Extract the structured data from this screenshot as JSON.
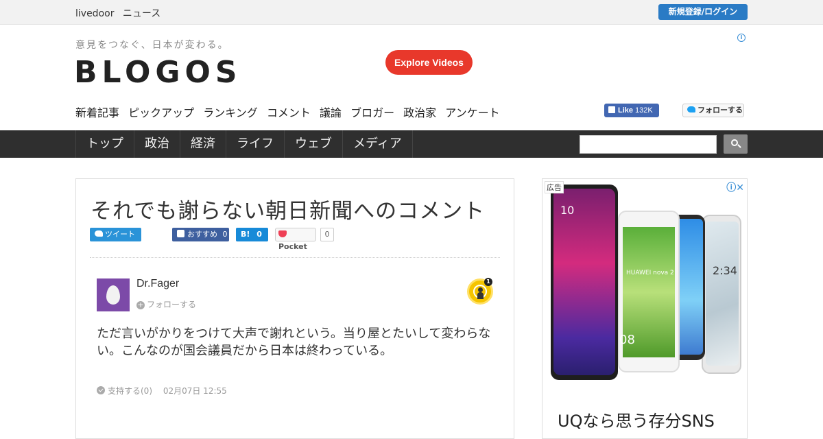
{
  "topbar": {
    "brand_1": "livedoor",
    "brand_2": "ニュース",
    "login_label": "新規登録/ログイン"
  },
  "masthead": {
    "tagline": "意見をつなぐ、日本が変わる。",
    "logo": "BLOGOS",
    "explore_label": "Explore Videos"
  },
  "subnav": [
    "新着記事",
    "ピックアップ",
    "ランキング",
    "コメント",
    "議論",
    "ブロガー",
    "政治家",
    "アンケート"
  ],
  "social": {
    "like_label": "Like",
    "like_count": "132K",
    "follow_label": "フォローする"
  },
  "navbar": {
    "items": [
      "トップ",
      "政治",
      "経済",
      "ライフ",
      "ウェブ",
      "メディア"
    ],
    "search_placeholder": ""
  },
  "article": {
    "title": "それでも謝らない朝日新聞へのコメント",
    "share": {
      "tweet": "ツイート",
      "fb_recommend": "おすすめ",
      "fb_count": "0",
      "hatena_icon": "B!",
      "hatena_count": "0",
      "pocket_label": "Pocket",
      "pocket_count": "0"
    },
    "user": {
      "name": "Dr.Fager",
      "follow_label": "フォローする",
      "badge_count": "1"
    },
    "comment": "ただ言いがかりをつけて大声で謝れという。当り屋とたいして変わらない。こんなのが国会議員だから日本は終わっている。",
    "support_label": "支持する(0)",
    "date": "02月07日 12:55"
  },
  "ad": {
    "label": "広告",
    "brand_on_phone": "HUAWEI nova 2",
    "phone_time_1": "10",
    "phone_time_1b": "08",
    "phone_time_2": "2:34",
    "text": "UQなら思う存分SNS"
  },
  "colors": {
    "accent_blue": "#2a7bc5",
    "explore_red": "#e8382b",
    "nav_dark": "#2f2f2f"
  }
}
